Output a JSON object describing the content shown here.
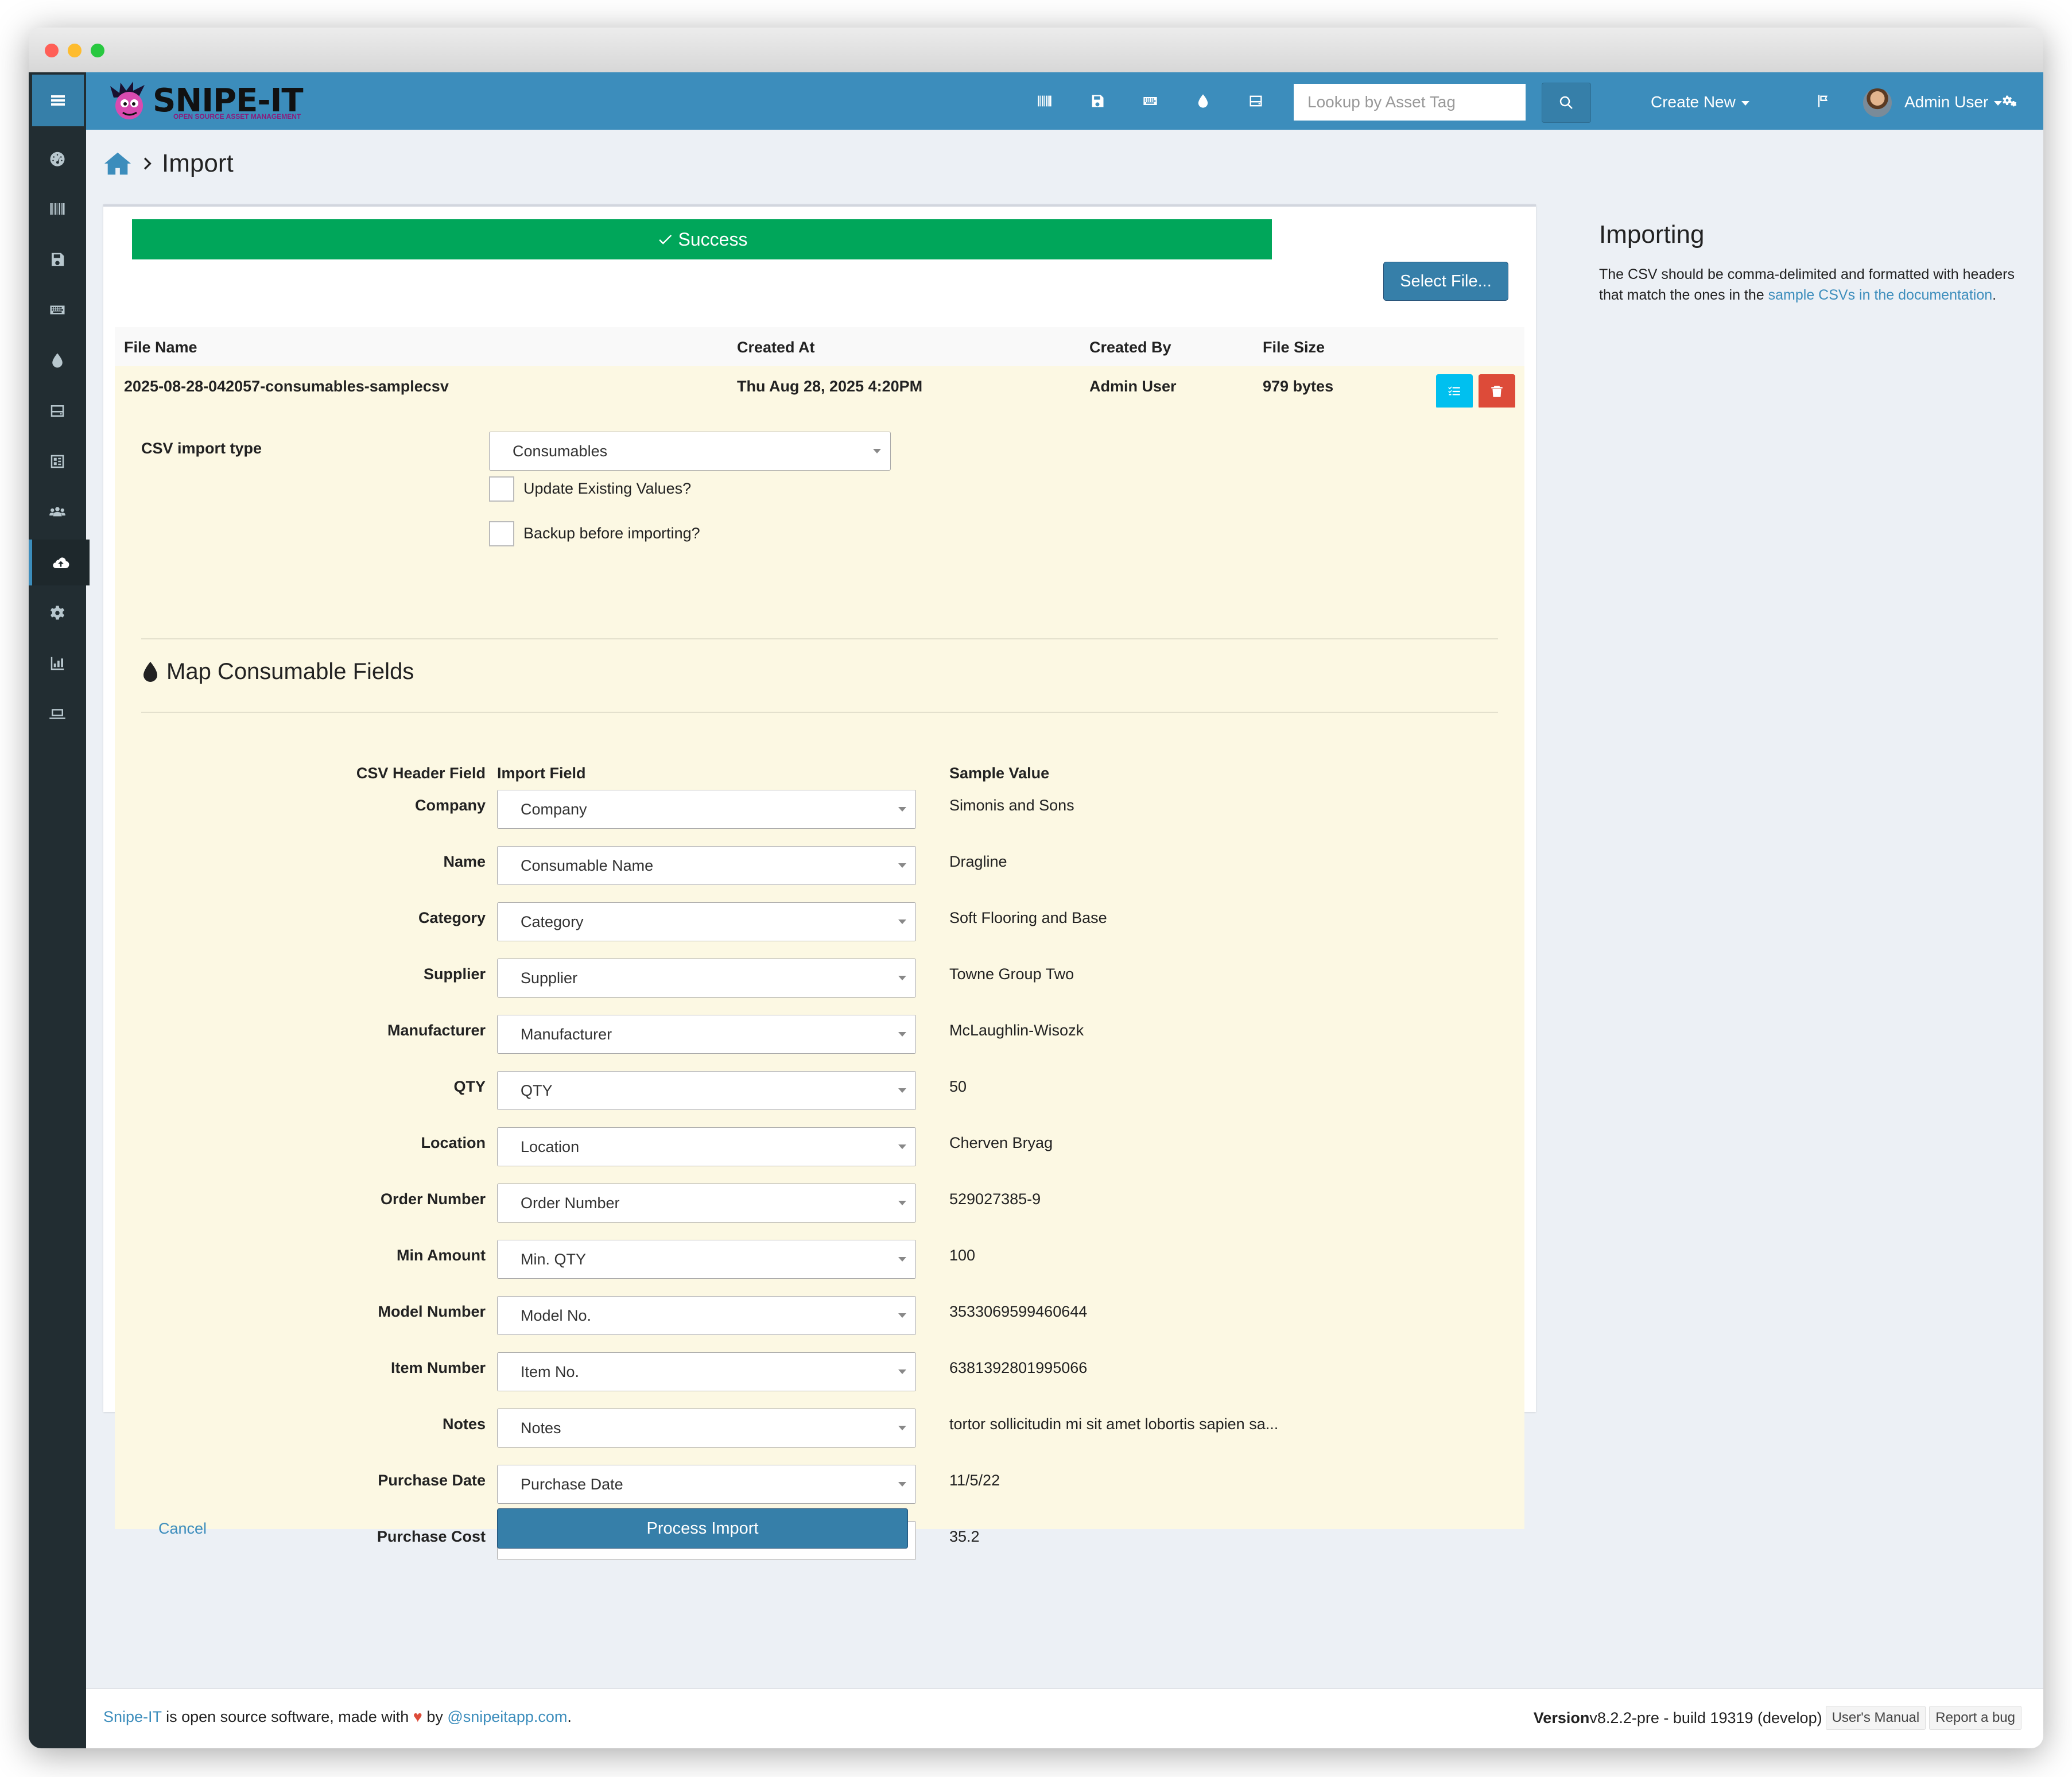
{
  "app": {
    "logo_text": "SNIPE-IT",
    "logo_subtitle": "OPEN SOURCE ASSET MANAGEMENT"
  },
  "sidebar": {
    "items": [
      {
        "icon": "dashboard-icon"
      },
      {
        "icon": "barcode-icon"
      },
      {
        "icon": "floppy-disk-icon"
      },
      {
        "icon": "keyboard-icon"
      },
      {
        "icon": "droplet-icon"
      },
      {
        "icon": "hard-drive-icon"
      },
      {
        "icon": "predefined-kits-icon"
      },
      {
        "icon": "users-icon"
      },
      {
        "icon": "cloud-upload-icon",
        "active": true
      },
      {
        "icon": "gear-icon"
      },
      {
        "icon": "chart-icon"
      },
      {
        "icon": "laptop-icon"
      }
    ]
  },
  "navbar": {
    "search_placeholder": "Lookup by Asset Tag",
    "create_new": "Create New",
    "user_name": "Admin User"
  },
  "breadcrumb": {
    "page_title": "Import"
  },
  "status": {
    "success": "Success"
  },
  "buttons": {
    "select_file": "Select File...",
    "cancel": "Cancel",
    "process_import": "Process Import"
  },
  "files_table": {
    "headers": {
      "file_name": "File Name",
      "created_at": "Created At",
      "created_by": "Created By",
      "file_size": "File Size"
    },
    "row": {
      "file_name": "2025-08-28-042057-consumables-samplecsv",
      "created_at": "Thu Aug 28, 2025 4:20PM",
      "created_by": "Admin User",
      "file_size": "979 bytes"
    }
  },
  "import_options": {
    "type_label": "CSV import type",
    "type_value": "Consumables",
    "update_existing": "Update Existing Values?",
    "backup_before": "Backup before importing?"
  },
  "mapping": {
    "title": "Map Consumable Fields",
    "headers": {
      "csv_header": "CSV Header Field",
      "import_field": "Import Field",
      "sample_value": "Sample Value"
    },
    "rows": [
      {
        "csv": "Company",
        "field": "Company",
        "sample": "Simonis and Sons"
      },
      {
        "csv": "Name",
        "field": "Consumable Name",
        "sample": "Dragline"
      },
      {
        "csv": "Category",
        "field": "Category",
        "sample": "Soft Flooring and Base"
      },
      {
        "csv": "Supplier",
        "field": "Supplier",
        "sample": "Towne Group Two"
      },
      {
        "csv": "Manufacturer",
        "field": "Manufacturer",
        "sample": "McLaughlin-Wisozk"
      },
      {
        "csv": "QTY",
        "field": "QTY",
        "sample": "50"
      },
      {
        "csv": "Location",
        "field": "Location",
        "sample": "Cherven Bryag"
      },
      {
        "csv": "Order Number",
        "field": "Order Number",
        "sample": "529027385-9"
      },
      {
        "csv": "Min Amount",
        "field": "Min. QTY",
        "sample": "100"
      },
      {
        "csv": "Model Number",
        "field": "Model No.",
        "sample": "3533069599460644"
      },
      {
        "csv": "Item Number",
        "field": "Item No.",
        "sample": "6381392801995066"
      },
      {
        "csv": "Notes",
        "field": "Notes",
        "sample": "tortor sollicitudin mi sit amet lobortis sapien sa..."
      },
      {
        "csv": "Purchase Date",
        "field": "Purchase Date",
        "sample": "11/5/22"
      },
      {
        "csv": "Purchase Cost",
        "field": "Purchase Cost",
        "sample": "35.2"
      }
    ]
  },
  "help": {
    "title": "Importing",
    "text_before": "The CSV should be comma-delimited and formatted with headers that match the ones in the ",
    "link": "sample CSVs in the documentation",
    "text_after": "."
  },
  "footer": {
    "brand": "Snipe-IT",
    "text_mid": " is open source software, made with ",
    "heart": "♥",
    "text_by": " by ",
    "handle": "@snipeitapp.com",
    "text_end": ".",
    "version_label": "Version",
    "version_value": " v8.2.2-pre - build 19319 (develop)",
    "users_manual": "User's Manual",
    "report_bug": "Report a bug"
  },
  "colors": {
    "navbar": "#3c8dbc",
    "sidebar": "#222d32",
    "success": "#00a65a",
    "danger": "#dd4b39",
    "info": "#00c0ef",
    "primary": "#367fa9",
    "panel_warning": "#fcf8e3"
  }
}
